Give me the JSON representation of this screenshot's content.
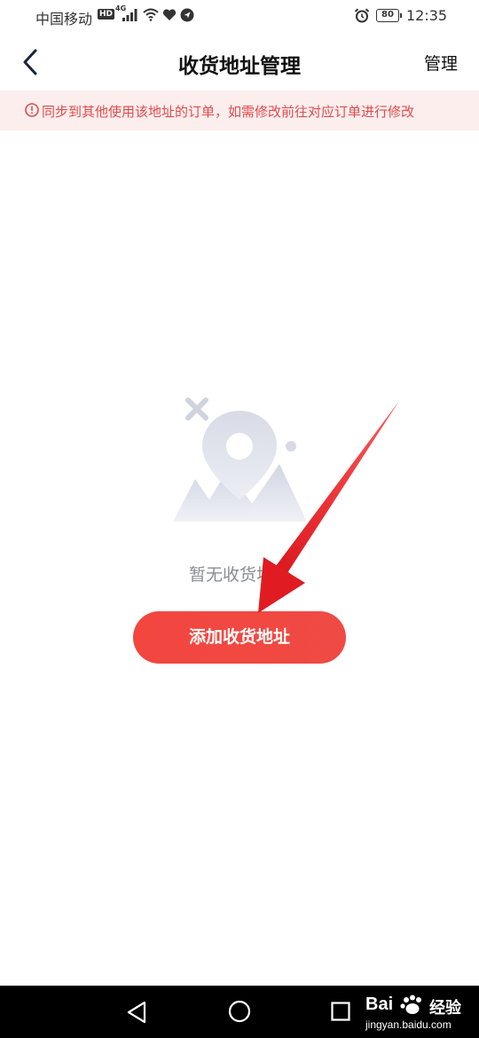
{
  "status_bar": {
    "carrier": "中国移动",
    "hd": "HD",
    "network": "4G",
    "battery": "80",
    "time": "12:35"
  },
  "header": {
    "title": "收货地址管理",
    "manage_label": "管理"
  },
  "notice": {
    "text": "同步到其他使用该地址的订单，如需修改前往对应订单进行修改"
  },
  "empty_state": {
    "message": "暂无收货地址"
  },
  "add_button": {
    "label": "添加收货地址"
  },
  "colors": {
    "accent": "#f2463f",
    "notice_bg": "#fdeeee",
    "notice_text": "#e24a4a",
    "annotation_arrow": "#e8222a"
  },
  "watermark": {
    "brand": "Bai",
    "brand_suffix": "经验",
    "url": "jingyan.baidu.com"
  },
  "icons": {
    "back": "chevron-left-icon",
    "notice": "info-circle-icon",
    "illustration": "location-pin-mountain-icon",
    "sys_back": "triangle-back-icon",
    "sys_home": "circle-home-icon",
    "sys_recent": "square-recent-icon"
  }
}
